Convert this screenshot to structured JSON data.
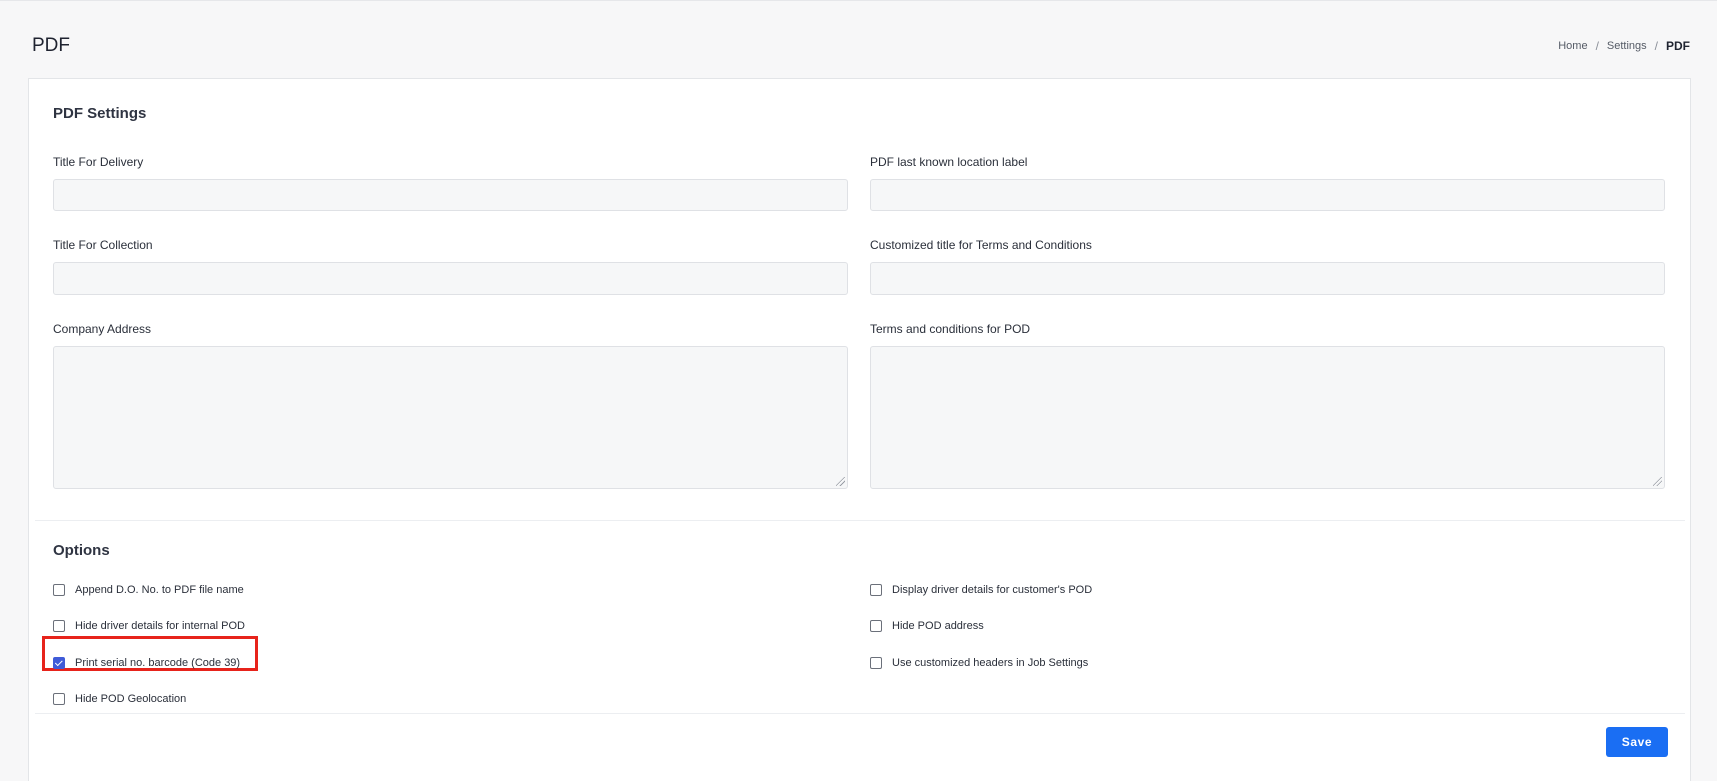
{
  "page": {
    "title": "PDF",
    "breadcrumb": [
      "Home",
      "Settings",
      "PDF"
    ]
  },
  "pdf_settings": {
    "heading": "PDF Settings",
    "fields": {
      "title_for_delivery": {
        "label": "Title For Delivery",
        "value": ""
      },
      "title_for_collection": {
        "label": "Title For Collection",
        "value": ""
      },
      "company_address": {
        "label": "Company Address",
        "value": ""
      },
      "pdf_last_known_location_label": {
        "label": "PDF last known location label",
        "value": ""
      },
      "customized_title_terms": {
        "label": "Customized title for Terms and Conditions",
        "value": ""
      },
      "terms_for_pod": {
        "label": "Terms and conditions for POD",
        "value": ""
      }
    }
  },
  "options": {
    "heading": "Options",
    "left": [
      {
        "label": "Append D.O. No. to PDF file name",
        "checked": false
      },
      {
        "label": "Hide driver details for internal POD",
        "checked": false
      },
      {
        "label": "Print serial no. barcode (Code 39)",
        "checked": true
      },
      {
        "label": "Hide POD Geolocation",
        "checked": false
      }
    ],
    "right": [
      {
        "label": "Display driver details for customer's POD",
        "checked": false
      },
      {
        "label": "Hide POD address",
        "checked": false
      },
      {
        "label": "Use customized headers in Job Settings",
        "checked": false
      }
    ]
  },
  "actions": {
    "save_label": "Save"
  },
  "colors": {
    "primary": "#1a6ef3",
    "checkbox": "#3f5bd8",
    "highlight": "#e7231b"
  }
}
